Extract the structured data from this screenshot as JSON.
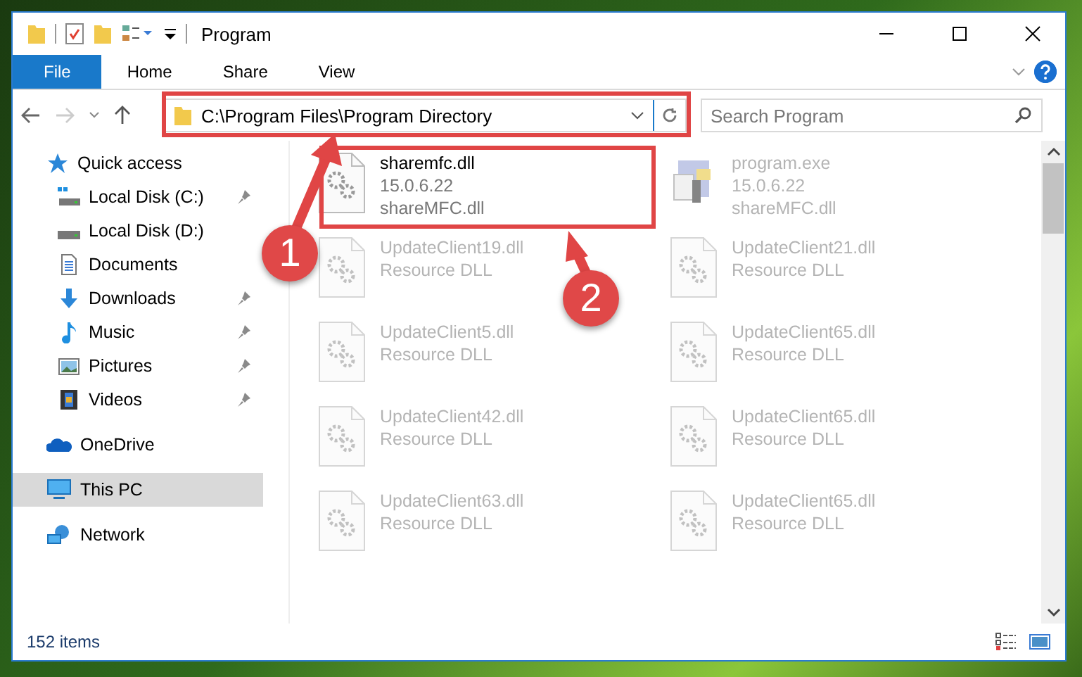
{
  "window": {
    "title": "Program"
  },
  "ribbon_tabs": [
    {
      "label": "File",
      "selected": true
    },
    {
      "label": "Home",
      "selected": false
    },
    {
      "label": "Share",
      "selected": false
    },
    {
      "label": "View",
      "selected": false
    }
  ],
  "address_bar": {
    "path": "C:\\Program Files\\Program Directory"
  },
  "search": {
    "placeholder": "Search Program"
  },
  "sidebar": {
    "items": [
      {
        "label": "Quick access",
        "kind": "star",
        "pinned": false,
        "selected": false,
        "children": [
          {
            "label": "Local Disk (C:)",
            "kind": "disk-c",
            "pinned": true,
            "selected": false
          },
          {
            "label": "Local Disk (D:)",
            "kind": "disk",
            "pinned": false,
            "selected": false
          },
          {
            "label": "Documents",
            "kind": "documents",
            "pinned": false,
            "selected": false
          },
          {
            "label": "Downloads",
            "kind": "downloads",
            "pinned": true,
            "selected": false
          },
          {
            "label": "Music",
            "kind": "music",
            "pinned": true,
            "selected": false
          },
          {
            "label": "Pictures",
            "kind": "pictures",
            "pinned": true,
            "selected": false
          },
          {
            "label": "Videos",
            "kind": "videos",
            "pinned": true,
            "selected": false
          }
        ]
      },
      {
        "label": "OneDrive",
        "kind": "cloud",
        "pinned": false,
        "selected": false
      },
      {
        "label": "This PC",
        "kind": "pc",
        "pinned": false,
        "selected": true
      },
      {
        "label": "Network",
        "kind": "network",
        "pinned": false,
        "selected": false
      }
    ]
  },
  "files": [
    {
      "name": "sharemfc.dll",
      "lines": [
        "15.0.6.22",
        "shareMFC.dll"
      ],
      "kind": "dll",
      "blurred": false
    },
    {
      "name": "program.exe",
      "lines": [
        "15.0.6.22",
        "shareMFC.dll"
      ],
      "kind": "exe",
      "blurred": true
    },
    {
      "name": "UpdateClient19.dll",
      "lines": [
        "Resource DLL"
      ],
      "kind": "dll",
      "blurred": true
    },
    {
      "name": "UpdateClient21.dll",
      "lines": [
        "Resource DLL"
      ],
      "kind": "dll",
      "blurred": true
    },
    {
      "name": "UpdateClient5.dll",
      "lines": [
        "Resource DLL"
      ],
      "kind": "dll",
      "blurred": true
    },
    {
      "name": "UpdateClient65.dll",
      "lines": [
        "Resource DLL"
      ],
      "kind": "dll",
      "blurred": true
    },
    {
      "name": "UpdateClient42.dll",
      "lines": [
        "Resource DLL"
      ],
      "kind": "dll",
      "blurred": true
    },
    {
      "name": "UpdateClient65.dll",
      "lines": [
        "Resource DLL"
      ],
      "kind": "dll",
      "blurred": true
    },
    {
      "name": "UpdateClient63.dll",
      "lines": [
        "Resource DLL"
      ],
      "kind": "dll",
      "blurred": true
    },
    {
      "name": "UpdateClient65.dll",
      "lines": [
        "Resource DLL"
      ],
      "kind": "dll",
      "blurred": true
    }
  ],
  "status_bar": {
    "item_count": "152 items"
  },
  "annotations": [
    {
      "number": "1"
    },
    {
      "number": "2"
    }
  ]
}
